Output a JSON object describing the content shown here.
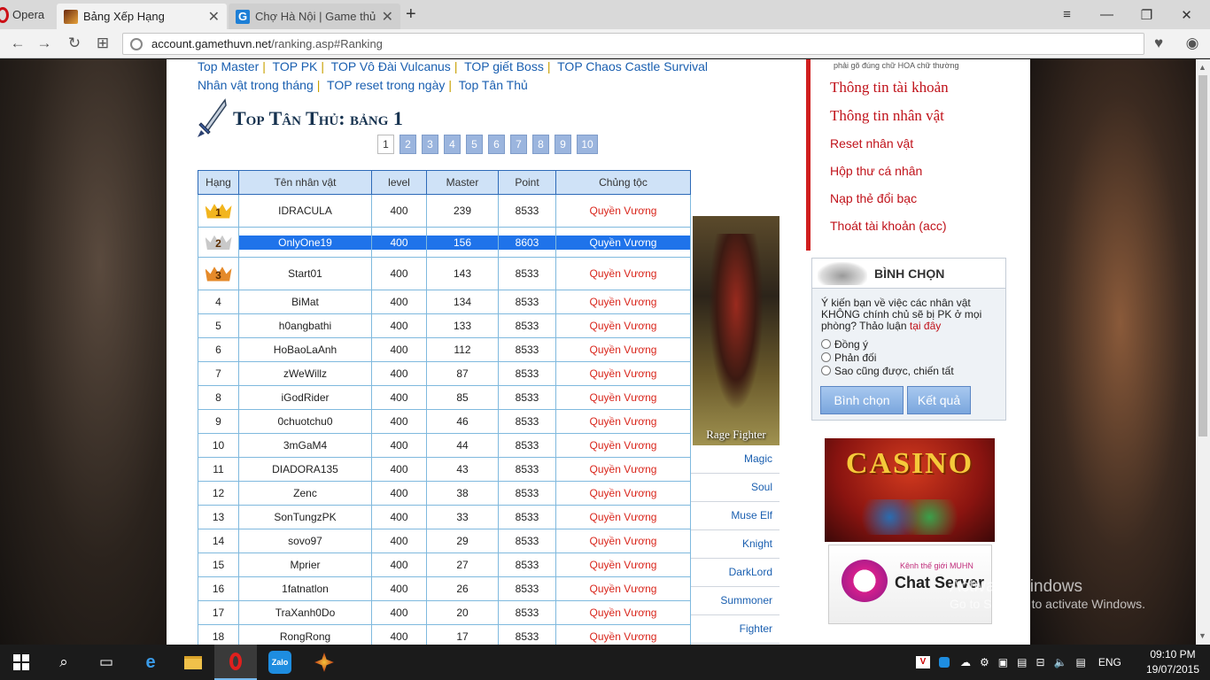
{
  "browser": {
    "app_name": "Opera",
    "tabs": [
      {
        "title": "Bảng Xếp Hạng",
        "active": true
      },
      {
        "title": "Chợ Hà Nội | Game thủ Vi",
        "active": false
      }
    ],
    "url_domain": "account.gamethuvn.net",
    "url_path": "/ranking.asp#Ranking"
  },
  "nav_links": {
    "row1": [
      "Top Master",
      "TOP PK",
      "TOP Vô Đài Vulcanus",
      "TOP giết Boss",
      "TOP Chaos Castle Survival"
    ],
    "row2": [
      "Nhân vật trong tháng",
      "TOP reset trong ngày",
      "Top Tân Thủ"
    ]
  },
  "ranking": {
    "title": "Top Tân Thủ: bảng 1",
    "pages": [
      "1",
      "2",
      "3",
      "4",
      "5",
      "6",
      "7",
      "8",
      "9",
      "10"
    ],
    "current_page": "1",
    "columns": [
      "Hạng",
      "Tên nhân vật",
      "level",
      "Master",
      "Point",
      "Chủng tộc"
    ],
    "rows": [
      {
        "rank": "1",
        "name": "IDRACULA",
        "level": "400",
        "master": "239",
        "point": "8533",
        "race": "Quyền Vương"
      },
      {
        "rank": "2",
        "name": "OnlyOne19",
        "level": "400",
        "master": "156",
        "point": "8603",
        "race": "Quyền Vương"
      },
      {
        "rank": "3",
        "name": "Start01",
        "level": "400",
        "master": "143",
        "point": "8533",
        "race": "Quyền Vương"
      },
      {
        "rank": "4",
        "name": "BiMat",
        "level": "400",
        "master": "134",
        "point": "8533",
        "race": "Quyền Vương"
      },
      {
        "rank": "5",
        "name": "h0angbathi",
        "level": "400",
        "master": "133",
        "point": "8533",
        "race": "Quyền Vương"
      },
      {
        "rank": "6",
        "name": "HoBaoLaAnh",
        "level": "400",
        "master": "112",
        "point": "8533",
        "race": "Quyền Vương"
      },
      {
        "rank": "7",
        "name": "zWeWillz",
        "level": "400",
        "master": "87",
        "point": "8533",
        "race": "Quyền Vương"
      },
      {
        "rank": "8",
        "name": "iGodRider",
        "level": "400",
        "master": "85",
        "point": "8533",
        "race": "Quyền Vương"
      },
      {
        "rank": "9",
        "name": "0chuotchu0",
        "level": "400",
        "master": "46",
        "point": "8533",
        "race": "Quyền Vương"
      },
      {
        "rank": "10",
        "name": "3mGaM4",
        "level": "400",
        "master": "44",
        "point": "8533",
        "race": "Quyền Vương"
      },
      {
        "rank": "11",
        "name": "DIADORA135",
        "level": "400",
        "master": "43",
        "point": "8533",
        "race": "Quyền Vương"
      },
      {
        "rank": "12",
        "name": "Zenc",
        "level": "400",
        "master": "38",
        "point": "8533",
        "race": "Quyền Vương"
      },
      {
        "rank": "13",
        "name": "SonTungzPK",
        "level": "400",
        "master": "33",
        "point": "8533",
        "race": "Quyền Vương"
      },
      {
        "rank": "14",
        "name": "sovo97",
        "level": "400",
        "master": "29",
        "point": "8533",
        "race": "Quyền Vương"
      },
      {
        "rank": "15",
        "name": "Mprier",
        "level": "400",
        "master": "27",
        "point": "8533",
        "race": "Quyền Vương"
      },
      {
        "rank": "16",
        "name": "1fatnatlon",
        "level": "400",
        "master": "26",
        "point": "8533",
        "race": "Quyền Vương"
      },
      {
        "rank": "17",
        "name": "TraXanh0Do",
        "level": "400",
        "master": "20",
        "point": "8533",
        "race": "Quyền Vương"
      },
      {
        "rank": "18",
        "name": "RongRong",
        "level": "400",
        "master": "17",
        "point": "8533",
        "race": "Quyền Vương"
      }
    ],
    "medal_colors": {
      "gold": "#f2b51e",
      "silver": "#c9c9c9",
      "bronze": "#e58a2a"
    }
  },
  "side_image_caption": "Rage Fighter",
  "class_links": [
    "Magic",
    "Soul",
    "Muse Elf",
    "Knight",
    "DarkLord",
    "Summoner",
    "Fighter"
  ],
  "account_menu": {
    "note": "phải gõ đúng chữ HOA chữ thường",
    "primary": [
      "Thông tin tài khoản",
      "Thông tin nhân vật"
    ],
    "secondary": [
      "Reset nhân vật",
      "Hộp thư cá nhân",
      "Nạp thẻ đổi bạc",
      "Thoát tài khoản (acc)"
    ]
  },
  "poll": {
    "heading": "BÌNH CHỌN",
    "question": "Ý kiến bạn về việc các nhân vật KHÔNG chính chủ sẽ bị PK ở mọi phòng? Thảo luận",
    "link_text": "tại đây",
    "options": [
      "Đồng ý",
      "Phản đối",
      "Sao cũng được, chiến tất"
    ],
    "vote_button": "Bình chọn",
    "result_button": "Kết quả"
  },
  "banners": {
    "casino": "CASINO",
    "chat_small": "Kênh thế giới MUHN",
    "chat_big": "Chat Server"
  },
  "watermark": {
    "line1": "Activate Windows",
    "line2": "Go to Settings to activate Windows."
  },
  "taskbar": {
    "language": "ENG",
    "time": "09:10 PM",
    "date": "19/07/2015",
    "zalo_label": "Zalo"
  },
  "colors": {
    "accent_red": "#c0121a",
    "link_blue": "#1a5fb0",
    "header_blue": "#cfe2f7",
    "selection": "#1f73ea"
  }
}
